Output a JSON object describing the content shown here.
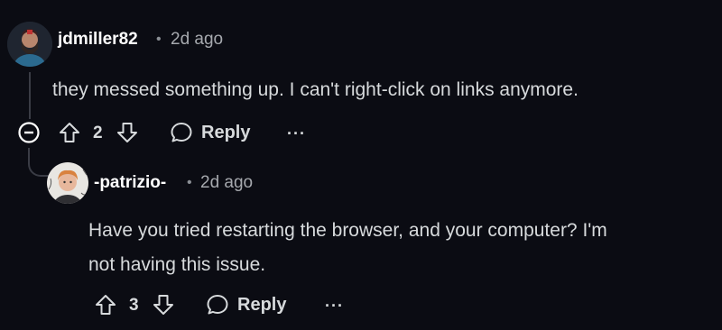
{
  "comments": [
    {
      "author": "jdmiller82",
      "separator": "•",
      "time": "2d ago",
      "text": "they messed something up. I can't right-click on links anymore.",
      "score": "2",
      "reply_label": "Reply",
      "more_label": "···",
      "avatar_icon": "user-avatar-icon"
    },
    {
      "author": "-patrizio-",
      "separator": "•",
      "time": "2d ago",
      "text_lines": [
        "Have you tried restarting the browser, and your computer? I'm",
        "not having this issue."
      ],
      "score": "3",
      "reply_label": "Reply",
      "more_label": "···",
      "avatar_icon": "user-avatar-icon"
    }
  ],
  "icons": {
    "collapse": "collapse-thread-icon",
    "upvote": "upvote-arrow-icon",
    "downvote": "downvote-arrow-icon",
    "reply": "speech-bubble-icon"
  },
  "colors": {
    "background": "#0b0c13",
    "text": "#d7dadc",
    "muted": "#a6a9ae"
  }
}
